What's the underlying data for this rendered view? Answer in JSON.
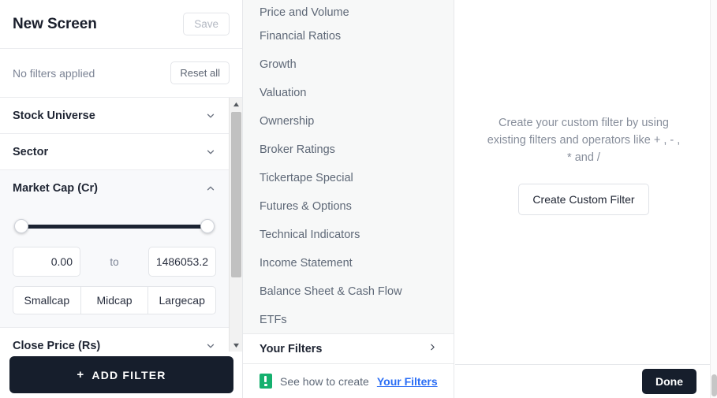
{
  "sidebar": {
    "title": "New Screen",
    "save_label": "Save",
    "no_filters_text": "No filters applied",
    "reset_label": "Reset all",
    "sections": [
      {
        "name": "Stock Universe",
        "expanded": false,
        "chevron": "chevron-down-icon"
      },
      {
        "name": "Sector",
        "expanded": false,
        "chevron": "chevron-down-icon"
      },
      {
        "name": "Market Cap (Cr)",
        "expanded": true,
        "chevron": "chevron-up-icon"
      },
      {
        "name": "Close Price (Rs)",
        "expanded": false,
        "chevron": "chevron-down-icon"
      }
    ],
    "market_cap": {
      "min_value": "0.00",
      "max_value": "1486053.2",
      "to_label": "to",
      "presets": [
        "Smallcap",
        "Midcap",
        "Largecap"
      ]
    },
    "add_filter_label": "ADD FILTER",
    "add_filter_plus": "+"
  },
  "categories": [
    "Price and Volume",
    "Financial Ratios",
    "Growth",
    "Valuation",
    "Ownership",
    "Broker Ratings",
    "Tickertape Special",
    "Futures & Options",
    "Technical Indicators",
    "Income Statement",
    "Balance Sheet & Cash Flow",
    "ETFs"
  ],
  "your_filters": {
    "label": "Your Filters",
    "chevron": "chevron-right-icon"
  },
  "see_how": {
    "icon": "video-icon",
    "text": "See how to create",
    "link_text": "Your Filters"
  },
  "custom_filter": {
    "description": "Create your custom filter by using existing filters and operators like + , - , * and /",
    "button_label": "Create Custom Filter"
  },
  "footer": {
    "done_label": "Done"
  },
  "colors": {
    "accent_dark": "#161e2c",
    "link_blue": "#2a6df5",
    "video_green": "#15b06e",
    "muted_text": "#7c8495"
  }
}
